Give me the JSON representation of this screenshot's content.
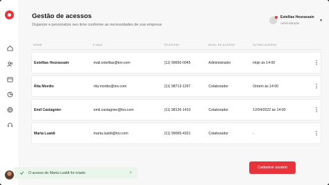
{
  "page": {
    "title": "Gestão de acessos",
    "subtitle": "Organize e personalize seu time conforme as necessidades de sua empresa"
  },
  "user": {
    "name": "Estellias Heurassain",
    "role": "Administrador",
    "menu_icon": "chevron-down-icon"
  },
  "sidebar": {
    "icons": [
      "home-icon",
      "users-icon",
      "calendar-icon",
      "pie-chart-icon",
      "globe-icon",
      "headset-icon"
    ]
  },
  "table": {
    "headers": [
      "NOME",
      "E-MAIL",
      "TELEFONE",
      "NÍVEL DE ACESSO",
      "ÚLTIMO ACESSO"
    ],
    "rows": [
      {
        "name": "Estellias Heurassain",
        "email": "mail.estellias@tov.com",
        "phone": "(11) 99650-0045",
        "level": "Administrador",
        "last": "Hoje às 14:00"
      },
      {
        "name": "Rita Mordio",
        "email": "rita.mordio@tov.com",
        "phone": "(11) 98713-1267",
        "level": "Colaborador",
        "last": "Ontem às 14:00"
      },
      {
        "name": "Emil Castagnier",
        "email": "emil.castagnier@tov.com",
        "phone": "(11) 98126-1410",
        "level": "Colaborador",
        "last": "12/04/2022 às 14:00"
      },
      {
        "name": "Marta Lualdi",
        "email": "marta.lualdi@tov.com",
        "phone": "(11) 99065-4321",
        "level": "Colaborador",
        "last": "-"
      }
    ]
  },
  "toast": {
    "text": "O acesso de Marta Lualdi foi criado.",
    "close": "×"
  },
  "actions": {
    "add_user": "Cadastrar usuário"
  },
  "colors": {
    "accent": "#e8333b",
    "toast_bg": "#eaf6ec"
  }
}
